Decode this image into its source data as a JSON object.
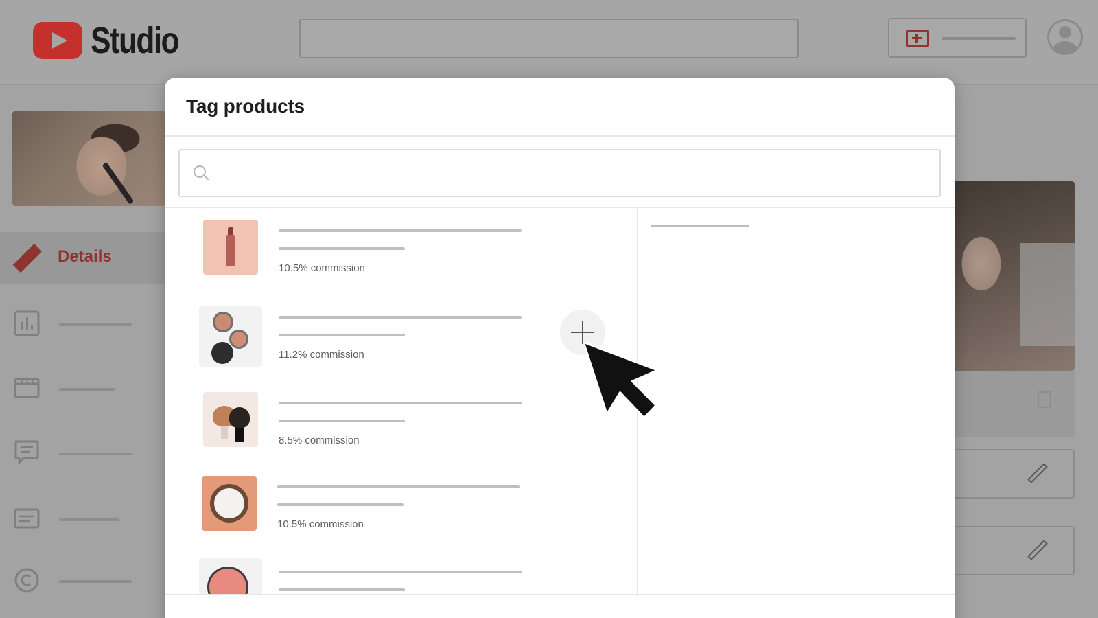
{
  "app": {
    "logo_text": "Studio",
    "brand_color": "#c5302c",
    "accent_color": "#8e3330"
  },
  "sidebar": {
    "active_item": {
      "label": "Details",
      "icon": "pencil-icon"
    },
    "items": [
      {
        "icon": "analytics-icon"
      },
      {
        "icon": "editor-icon"
      },
      {
        "icon": "comments-icon"
      },
      {
        "icon": "subtitles-icon"
      },
      {
        "icon": "copyright-icon"
      }
    ]
  },
  "modal": {
    "title": "Tag products",
    "search": {
      "placeholder": "",
      "value": ""
    },
    "products": [
      {
        "thumb": "lipstick",
        "commission": "10.5% commission"
      },
      {
        "thumb": "makeup-pots",
        "commission": "11.2% commission"
      },
      {
        "thumb": "brushes",
        "commission": "8.5% commission"
      },
      {
        "thumb": "cream-jar",
        "commission": "10.5% commission"
      },
      {
        "thumb": "blush-compact",
        "commission": ""
      }
    ],
    "add_button_icon": "plus-icon"
  }
}
